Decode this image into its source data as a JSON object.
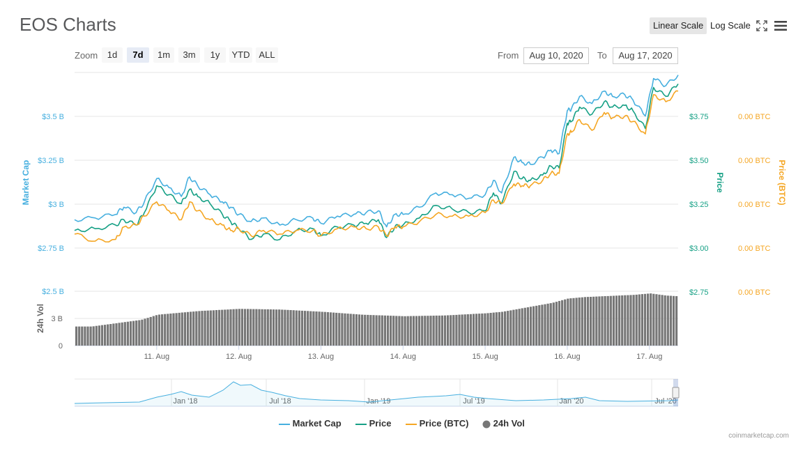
{
  "header": {
    "title": "EOS Charts",
    "linear_scale": "Linear Scale",
    "log_scale": "Log Scale",
    "fullscreen_icon": "expand-icon",
    "menu_icon": "hamburger-menu-icon"
  },
  "zoom": {
    "label": "Zoom",
    "buttons": [
      "1d",
      "7d",
      "1m",
      "3m",
      "1y",
      "YTD",
      "ALL"
    ],
    "active": "7d"
  },
  "range": {
    "from_label": "From",
    "from_value": "Aug 10, 2020",
    "to_label": "To",
    "to_value": "Aug 17, 2020"
  },
  "colors": {
    "market_cap": "#46afdf",
    "price": "#16a085",
    "price_btc": "#f5a623",
    "volume": "#777777"
  },
  "legend": [
    "Market Cap",
    "Price",
    "Price (BTC)",
    "24h Vol"
  ],
  "credit": "coinmarketcap.com",
  "chart_data": {
    "type": "line",
    "x_axis": {
      "ticks": [
        "11. Aug",
        "12. Aug",
        "13. Aug",
        "14. Aug",
        "15. Aug",
        "16. Aug",
        "17. Aug"
      ]
    },
    "y_left": {
      "label": "Market Cap",
      "ticks": [
        "$3.5 B",
        "$3.25 B",
        "$3 B",
        "$2.75 B"
      ],
      "range": [
        2.5,
        3.65
      ]
    },
    "y_right_price": {
      "label": "Price",
      "ticks": [
        "$3.75",
        "$3.50",
        "$3.25",
        "$3.00",
        "$2.75"
      ],
      "range": [
        2.75,
        3.9
      ]
    },
    "y_right_btc": {
      "label": "Price (BTC)",
      "ticks": [
        "0.00 BTC",
        "0.00 BTC",
        "0.00 BTC",
        "0.00 BTC",
        "0.00 BTC"
      ]
    },
    "volume_axis": {
      "label": "24h Vol",
      "ticks": [
        "$2.5 B",
        "3 B",
        "0"
      ]
    },
    "series": [
      {
        "name": "Market Cap",
        "x": [
          10.0,
          10.25,
          10.5,
          10.6,
          10.75,
          10.85,
          11.0,
          11.15,
          11.3,
          11.4,
          11.5,
          11.65,
          11.8,
          11.9,
          12.0,
          12.15,
          12.3,
          12.5,
          12.7,
          12.9,
          13.0,
          13.2,
          13.4,
          13.55,
          13.7,
          13.8,
          13.9,
          14.0,
          14.2,
          14.4,
          14.6,
          14.8,
          15.0,
          15.1,
          15.2,
          15.35,
          15.45,
          15.55,
          15.7,
          15.8,
          15.9,
          16.0,
          16.05,
          16.15,
          16.3,
          16.45,
          16.55,
          16.7,
          16.8,
          16.95,
          17.05,
          17.2,
          17.35
        ],
        "values": [
          2.83,
          2.84,
          2.86,
          2.9,
          2.87,
          2.93,
          3.06,
          3.01,
          2.96,
          3.07,
          3.02,
          2.97,
          2.93,
          2.9,
          2.86,
          2.82,
          2.84,
          2.8,
          2.83,
          2.84,
          2.81,
          2.85,
          2.86,
          2.87,
          2.88,
          2.79,
          2.86,
          2.86,
          2.9,
          2.98,
          2.97,
          2.95,
          2.97,
          3.05,
          2.98,
          3.18,
          3.15,
          3.14,
          3.18,
          3.22,
          3.2,
          3.44,
          3.45,
          3.52,
          3.48,
          3.55,
          3.52,
          3.53,
          3.5,
          3.41,
          3.62,
          3.58,
          3.64
        ]
      },
      {
        "name": "Price",
        "x": [
          10.0,
          10.25,
          10.5,
          10.6,
          10.75,
          10.85,
          11.0,
          11.15,
          11.3,
          11.4,
          11.5,
          11.65,
          11.8,
          11.9,
          12.0,
          12.15,
          12.3,
          12.5,
          12.7,
          12.9,
          13.0,
          13.2,
          13.4,
          13.55,
          13.7,
          13.8,
          13.9,
          14.0,
          14.2,
          14.4,
          14.6,
          14.8,
          15.0,
          15.1,
          15.2,
          15.35,
          15.45,
          15.55,
          15.7,
          15.8,
          15.9,
          16.0,
          16.05,
          16.15,
          16.3,
          16.45,
          16.55,
          16.7,
          16.8,
          16.95,
          17.05,
          17.2,
          17.35
        ],
        "values": [
          3.02,
          3.03,
          3.05,
          3.08,
          3.05,
          3.12,
          3.27,
          3.22,
          3.17,
          3.25,
          3.21,
          3.17,
          3.11,
          3.07,
          3.03,
          2.97,
          3.0,
          2.97,
          3.02,
          3.03,
          2.99,
          3.04,
          3.05,
          3.06,
          3.08,
          2.98,
          3.04,
          3.05,
          3.09,
          3.16,
          3.14,
          3.12,
          3.13,
          3.23,
          3.17,
          3.35,
          3.31,
          3.3,
          3.33,
          3.38,
          3.37,
          3.62,
          3.63,
          3.71,
          3.67,
          3.74,
          3.71,
          3.72,
          3.69,
          3.59,
          3.82,
          3.77,
          3.84
        ]
      },
      {
        "name": "Price (BTC)",
        "x": [
          10.0,
          10.25,
          10.5,
          10.6,
          10.75,
          10.85,
          11.0,
          11.15,
          11.3,
          11.4,
          11.5,
          11.65,
          11.8,
          11.9,
          12.0,
          12.15,
          12.3,
          12.5,
          12.7,
          12.9,
          13.0,
          13.2,
          13.4,
          13.55,
          13.7,
          13.8,
          13.9,
          14.0,
          14.2,
          14.4,
          14.6,
          14.8,
          15.0,
          15.1,
          15.2,
          15.35,
          15.45,
          15.55,
          15.7,
          15.8,
          15.9,
          16.0,
          16.05,
          16.15,
          16.3,
          16.45,
          16.55,
          16.7,
          16.8,
          16.95,
          17.05,
          17.2,
          17.35
        ],
        "values": [
          3.0,
          2.96,
          2.97,
          3.04,
          3.05,
          3.1,
          3.18,
          3.13,
          3.08,
          3.18,
          3.13,
          3.08,
          3.05,
          3.02,
          3.03,
          2.99,
          3.02,
          3.0,
          3.02,
          3.02,
          2.99,
          3.03,
          3.04,
          3.03,
          3.04,
          2.99,
          3.04,
          3.04,
          3.07,
          3.11,
          3.1,
          3.1,
          3.12,
          3.19,
          3.17,
          3.28,
          3.27,
          3.27,
          3.3,
          3.34,
          3.34,
          3.56,
          3.57,
          3.64,
          3.58,
          3.68,
          3.65,
          3.66,
          3.63,
          3.56,
          3.78,
          3.74,
          3.8
        ]
      }
    ],
    "volume": {
      "name": "24h Vol",
      "x": [
        10.0,
        10.2,
        10.4,
        10.6,
        10.8,
        11.0,
        11.5,
        12.0,
        12.5,
        13.0,
        13.5,
        14.0,
        14.5,
        15.0,
        15.2,
        15.4,
        15.6,
        15.8,
        16.0,
        16.2,
        16.4,
        16.6,
        16.8,
        17.0,
        17.2,
        17.35
      ],
      "values": [
        1.3,
        1.3,
        1.45,
        1.6,
        1.75,
        2.1,
        2.35,
        2.5,
        2.45,
        2.3,
        2.1,
        2.0,
        2.05,
        2.2,
        2.3,
        2.5,
        2.7,
        2.9,
        3.2,
        3.3,
        3.35,
        3.4,
        3.45,
        3.55,
        3.4,
        3.35
      ],
      "max": 3.6
    },
    "navigator": {
      "labels": [
        "Jan '18",
        "Jul '18",
        "Jan '19",
        "Jul '19",
        "Jan '20",
        "Jul '20"
      ]
    },
    "grid": true
  }
}
